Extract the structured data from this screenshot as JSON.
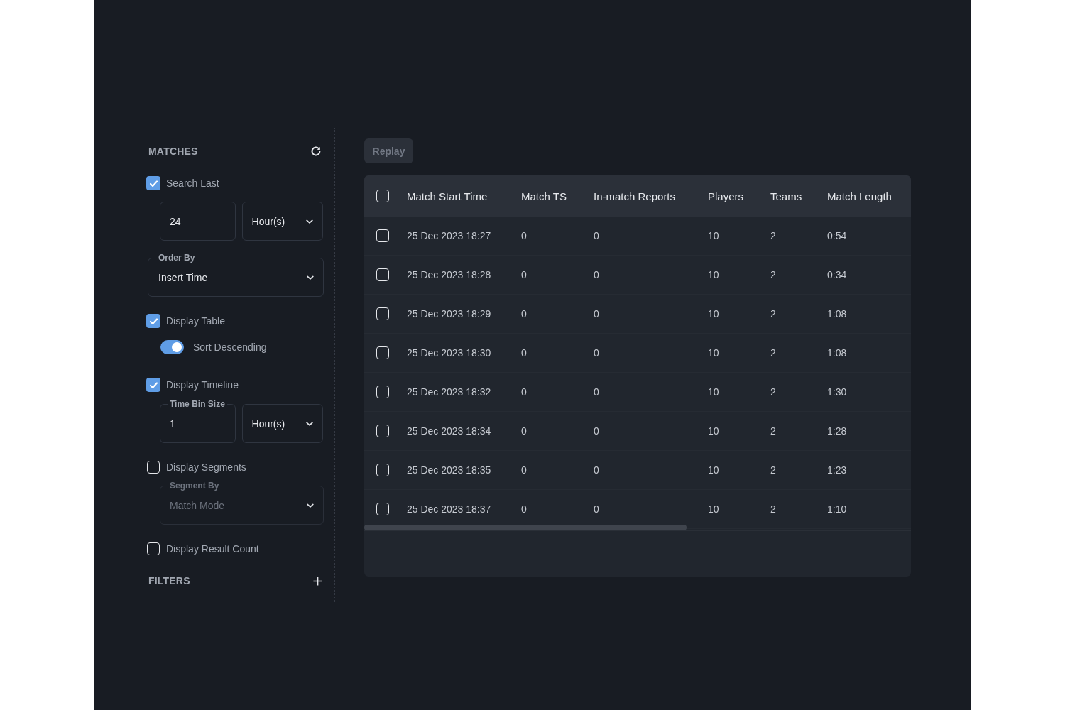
{
  "sidebar": {
    "matches_heading": "MATCHES",
    "search_last": {
      "label": "Search Last",
      "checked": true,
      "amount": "24",
      "unit": "Hour(s)"
    },
    "order_by": {
      "label": "Order By",
      "value": "Insert Time"
    },
    "display_table": {
      "label": "Display Table",
      "checked": true
    },
    "sort_descending": {
      "label": "Sort Descending",
      "on": true
    },
    "display_timeline": {
      "label": "Display Timeline",
      "checked": true
    },
    "time_bin_size": {
      "label": "Time Bin Size",
      "value": "1",
      "unit": "Hour(s)"
    },
    "display_segments": {
      "label": "Display Segments",
      "checked": false
    },
    "segment_by": {
      "label": "Segment By",
      "value": "Match Mode",
      "disabled": true
    },
    "display_result_count": {
      "label": "Display Result Count",
      "checked": false
    },
    "filters_heading": "FILTERS"
  },
  "replay_button": {
    "label": "Replay",
    "disabled": true
  },
  "table": {
    "select_all_checked": false,
    "columns": [
      "Match Start Time",
      "Match TS",
      "In-match Reports",
      "Players",
      "Teams",
      "Match Length"
    ],
    "rows": [
      {
        "checked": false,
        "cells": [
          "25 Dec 2023 18:27",
          "0",
          "0",
          "10",
          "2",
          "0:54"
        ]
      },
      {
        "checked": false,
        "cells": [
          "25 Dec 2023 18:28",
          "0",
          "0",
          "10",
          "2",
          "0:34"
        ]
      },
      {
        "checked": false,
        "cells": [
          "25 Dec 2023 18:29",
          "0",
          "0",
          "10",
          "2",
          "1:08"
        ]
      },
      {
        "checked": false,
        "cells": [
          "25 Dec 2023 18:30",
          "0",
          "0",
          "10",
          "2",
          "1:08"
        ]
      },
      {
        "checked": false,
        "cells": [
          "25 Dec 2023 18:32",
          "0",
          "0",
          "10",
          "2",
          "1:30"
        ]
      },
      {
        "checked": false,
        "cells": [
          "25 Dec 2023 18:34",
          "0",
          "0",
          "10",
          "2",
          "1:28"
        ]
      },
      {
        "checked": false,
        "cells": [
          "25 Dec 2023 18:35",
          "0",
          "0",
          "10",
          "2",
          "1:23"
        ]
      },
      {
        "checked": false,
        "cells": [
          "25 Dec 2023 18:37",
          "0",
          "0",
          "10",
          "2",
          "1:10"
        ]
      }
    ]
  }
}
